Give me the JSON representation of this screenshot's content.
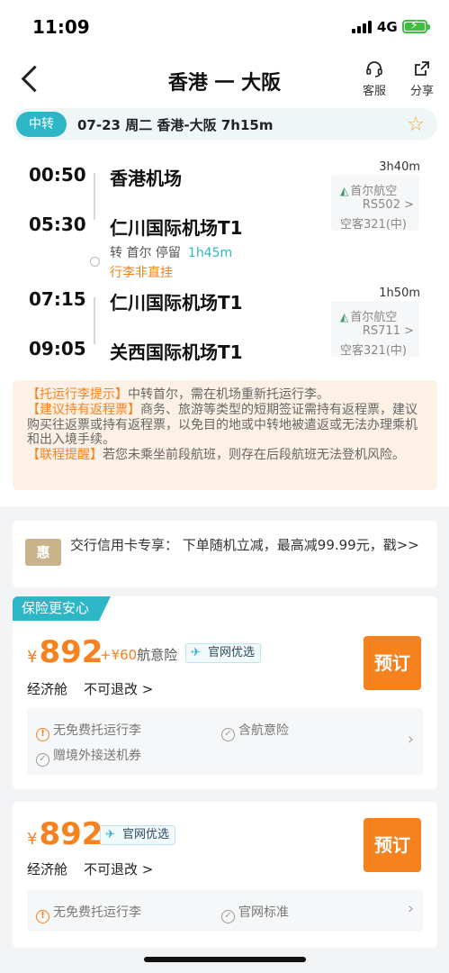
{
  "status": {
    "time": "11:09",
    "network": "4G"
  },
  "nav": {
    "title": "香港 一 大阪",
    "service_label": "客服",
    "share_label": "分享",
    "service_icon": "headset-icon",
    "share_icon": "share-icon"
  },
  "trip": {
    "transfer_tag": "中转",
    "summary": "07-23 周二  香港-大阪  7h15m"
  },
  "segments": [
    {
      "dep_time": "00:50",
      "dep_airport": "香港机场",
      "arr_time": "05:30",
      "arr_airport": "仁川国际机场T1",
      "duration": "3h40m",
      "airline": "首尔航空",
      "flight_no": "RS502 >",
      "aircraft": "空客321(中)"
    },
    {
      "dep_time": "07:15",
      "dep_airport": "仁川国际机场T1",
      "arr_time": "09:05",
      "arr_airport": "关西国际机场T1",
      "duration": "1h50m",
      "airline": "首尔航空",
      "flight_no": "RS711 >",
      "aircraft": "空客321(中)"
    }
  ],
  "stopover": {
    "text": "转 首尔 停留",
    "duration": "1h45m",
    "baggage_note": "行李非直挂"
  },
  "notice": {
    "h1": "【托运行李提示】",
    "t1": "中转首尔，需在机场重新托运行李。",
    "h2": "【建议持有返程票】",
    "t2": "商务、旅游等类型的短期签证需持有返程票，建议购买往返票或持有返程票，以免目的地或中转地被遣返或无法办理乘机和出入境手续。",
    "h3": "【联程提醒】",
    "t3": "若您未乘坐前段航班，则存在后段航班无法登机风险。"
  },
  "promo": {
    "icon_text": "惠",
    "text": "交行信用卡专享：  下单随机立减，最高减99.99元，戳>>"
  },
  "offers": [
    {
      "tag": "保险更安心",
      "currency": "¥",
      "price": "892",
      "addon_price": "+¥60",
      "addon_label": "航意险",
      "official_label": "官网优选",
      "cabin": "经济舱",
      "rule": "不可退改 >",
      "book_label": "预订",
      "features": [
        "无免费托运行李",
        "含航意险",
        "赠境外接送机券"
      ]
    },
    {
      "currency": "¥",
      "price": "892",
      "official_label": "官网优选",
      "cabin": "经济舱",
      "rule": "不可退改 >",
      "book_label": "预订",
      "features": [
        "无免费托运行李",
        "官网标准"
      ]
    }
  ],
  "colors": {
    "accent_orange": "#f5821f",
    "teal": "#2cb6c6"
  }
}
